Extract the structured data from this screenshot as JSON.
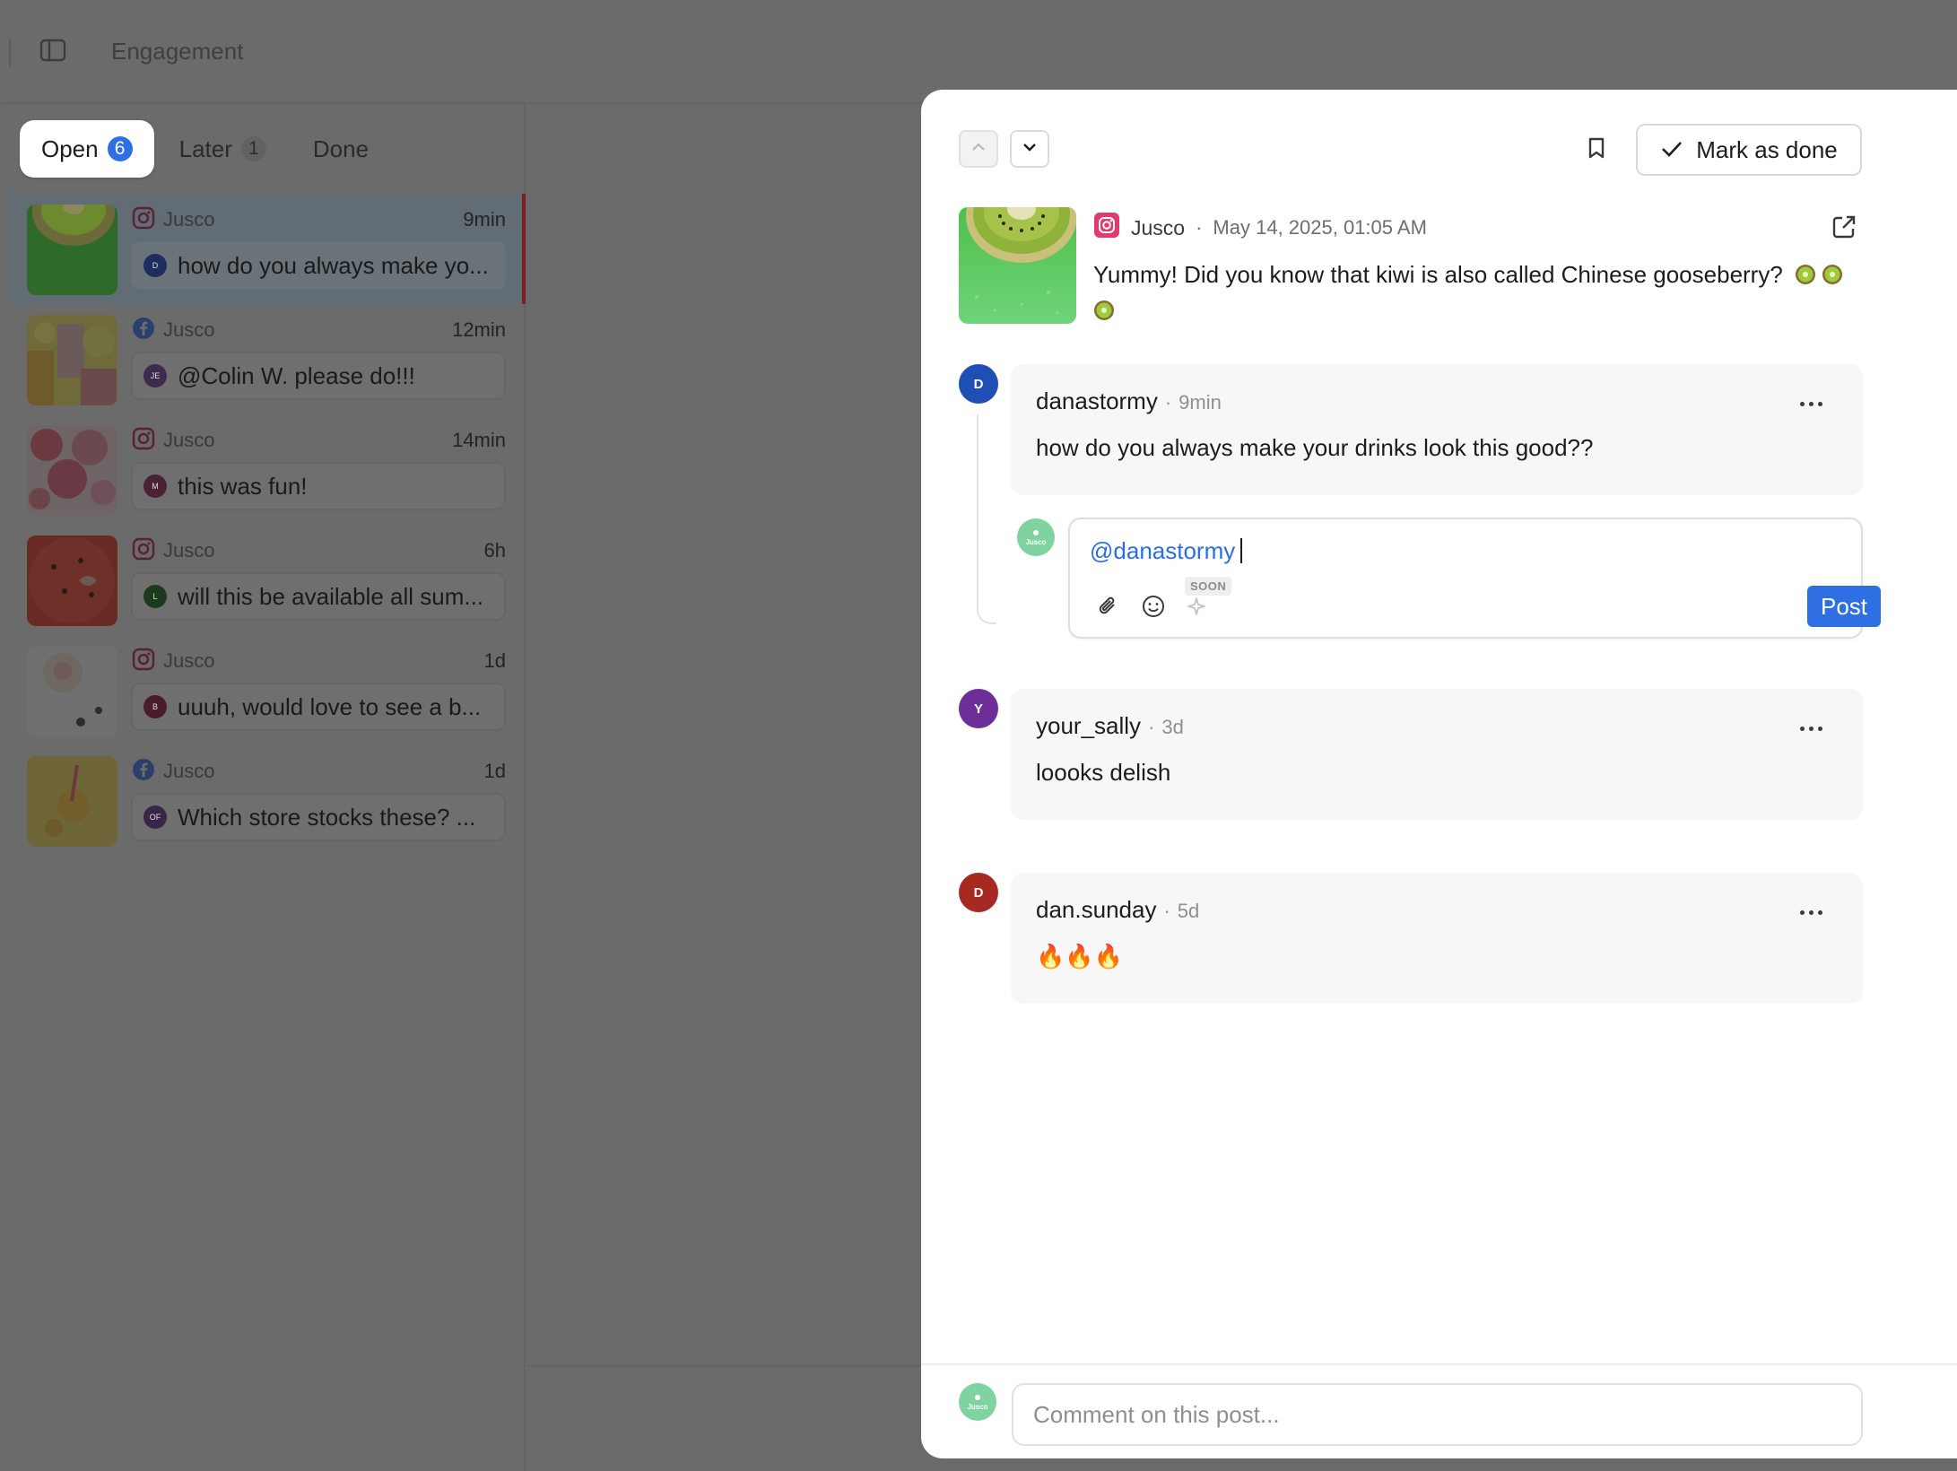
{
  "header": {
    "title": "Engagement"
  },
  "tabs": [
    {
      "label": "Open",
      "count": "6"
    },
    {
      "label": "Later",
      "count": "1"
    },
    {
      "label": "Done"
    }
  ],
  "conversations": [
    {
      "source": "Jusco",
      "network": "instagram",
      "time": "9min",
      "avatar_letter": "D",
      "avatar_color": "#1c2d5e",
      "snippet": "how do you always make yo...",
      "selected": true
    },
    {
      "source": "Jusco",
      "network": "facebook",
      "time": "12min",
      "avatar_letter": "JE",
      "avatar_color": "#3d2a4f",
      "snippet": "@Colin W. please do!!!"
    },
    {
      "source": "Jusco",
      "network": "instagram",
      "time": "14min",
      "avatar_letter": "M",
      "avatar_color": "#4a2235",
      "snippet": "this was fun!"
    },
    {
      "source": "Jusco",
      "network": "instagram",
      "time": "6h",
      "avatar_letter": "L",
      "avatar_color": "#1e3a1e",
      "snippet": "will this be available all sum..."
    },
    {
      "source": "Jusco",
      "network": "instagram",
      "time": "1d",
      "avatar_letter": "B",
      "avatar_color": "#4a1d2c",
      "snippet": "uuuh, would love to see a b..."
    },
    {
      "source": "Jusco",
      "network": "facebook",
      "time": "1d",
      "avatar_letter": "OF",
      "avatar_color": "#3a2548",
      "snippet": "Which store stocks these? ..."
    }
  ],
  "detail": {
    "mark_done_label": "Mark as done",
    "post": {
      "author": "Jusco",
      "separator": "·",
      "date": "May 14, 2025, 01:05 AM",
      "caption": "Yummy! Did you know that kiwi is also called Chinese gooseberry?"
    },
    "comments": [
      {
        "avatar_letter": "D",
        "avatar_color": "#1f4fb5",
        "user": "danastormy",
        "dot": "·",
        "ago": "9min",
        "text": "how do you always make your drinks look this good??"
      },
      {
        "avatar_letter": "Y",
        "avatar_color": "#6e2e9a",
        "user": "your_sally",
        "dot": "·",
        "ago": "3d",
        "text": "loooks delish"
      },
      {
        "avatar_letter": "D",
        "avatar_color": "#a62a22",
        "user": "dan.sunday",
        "dot": "·",
        "ago": "5d",
        "text": "🔥🔥🔥"
      }
    ],
    "reply": {
      "mention": "@danastormy",
      "soon_label": "SOON",
      "post_label": "Post"
    },
    "footer": {
      "placeholder": "Comment on this post..."
    }
  },
  "colors": {
    "accent": "#2f6fe4",
    "brand_green": "#7fd3a0",
    "selected_marker": "#7e2028"
  }
}
